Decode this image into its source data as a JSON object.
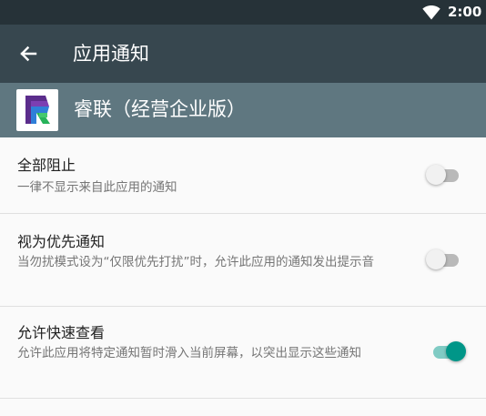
{
  "status_bar": {
    "time": "2:00",
    "wifi_icon": "wifi-full-icon"
  },
  "toolbar": {
    "back_icon": "arrow-back-icon",
    "title": "应用通知"
  },
  "app": {
    "icon": "app-logo-r-icon",
    "name": "睿联（经营企业版）"
  },
  "settings": [
    {
      "title": "全部阻止",
      "summary": "一律不显示来自此应用的通知",
      "enabled": false
    },
    {
      "title": "视为优先通知",
      "summary": "当勿扰模式设为“仅限优先打扰”时，允许此应用的通知发出提示音",
      "enabled": false
    },
    {
      "title": "允许快速查看",
      "summary": "允许此应用将特定通知暂时滑入当前屏幕，以突出显示这些通知",
      "enabled": true
    }
  ],
  "colors": {
    "status_bar": "#263238",
    "toolbar": "#37474f",
    "app_header": "#5f7780",
    "switch_on": "#009688",
    "switch_on_track": "#80cbc4"
  }
}
